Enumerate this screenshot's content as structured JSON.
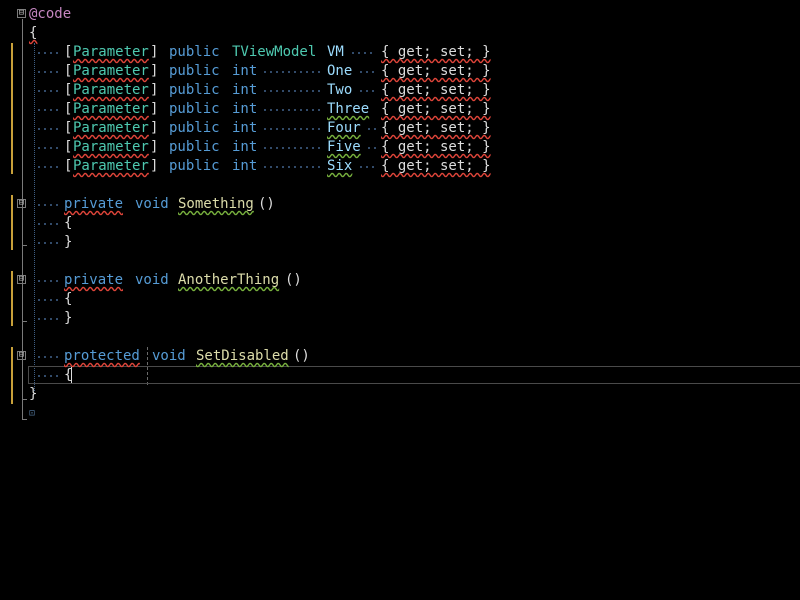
{
  "editor": {
    "line_1": {
      "razor": "@code"
    },
    "open_brace": "{",
    "close_brace": "}",
    "params": [
      {
        "attr_open": "[",
        "attr": "Parameter",
        "attr_close": "]",
        "mod": "public",
        "type": "TViewModel",
        "name": "VM",
        "accessors": "{ get; set; }"
      },
      {
        "attr_open": "[",
        "attr": "Parameter",
        "attr_close": "]",
        "mod": "public",
        "type": "int",
        "name": "One",
        "accessors": "{ get; set; }"
      },
      {
        "attr_open": "[",
        "attr": "Parameter",
        "attr_close": "]",
        "mod": "public",
        "type": "int",
        "name": "Two",
        "accessors": "{ get; set; }"
      },
      {
        "attr_open": "[",
        "attr": "Parameter",
        "attr_close": "]",
        "mod": "public",
        "type": "int",
        "name": "Three",
        "accessors": "{ get; set; }"
      },
      {
        "attr_open": "[",
        "attr": "Parameter",
        "attr_close": "]",
        "mod": "public",
        "type": "int",
        "name": "Four",
        "accessors": "{ get; set; }"
      },
      {
        "attr_open": "[",
        "attr": "Parameter",
        "attr_close": "]",
        "mod": "public",
        "type": "int",
        "name": "Five",
        "accessors": "{ get; set; }"
      },
      {
        "attr_open": "[",
        "attr": "Parameter",
        "attr_close": "]",
        "mod": "public",
        "type": "int",
        "name": "Six",
        "accessors": "{ get; set; }"
      }
    ],
    "methods": [
      {
        "mod": "private",
        "ret": "void",
        "name": "Something",
        "parens": "()",
        "body_open": "{",
        "body_close": "}"
      },
      {
        "mod": "private",
        "ret": "void",
        "name": "AnotherThing",
        "parens": "()",
        "body_open": "{",
        "body_close": "}"
      },
      {
        "mod": "protected",
        "ret": "void",
        "name": "SetDisabled",
        "parens": "()",
        "body_open": "{"
      }
    ],
    "outline_glyph": "⊟",
    "last_marker": "⊡"
  },
  "colors": {
    "keyword": "#569cd6",
    "type": "#4ec9b0",
    "method": "#dcdcaa",
    "property": "#9cdcfe",
    "razor": "#c586c0",
    "gutter_change": "#c8a03a",
    "squiggle_error": "#e0453a",
    "squiggle_warning": "#78b13e"
  }
}
